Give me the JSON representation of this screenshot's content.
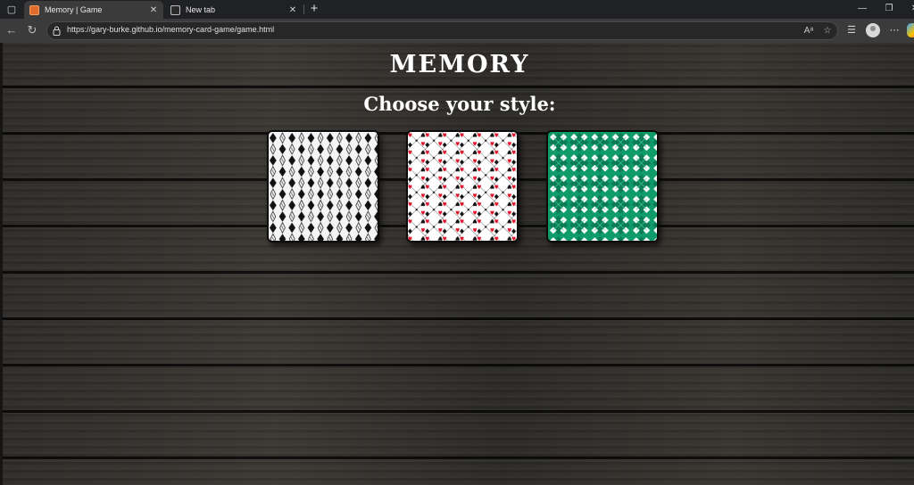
{
  "browser": {
    "tabs": [
      {
        "title": "Memory | Game",
        "active": true
      },
      {
        "title": "New tab",
        "active": false
      }
    ],
    "url": "https://gary-burke.github.io/memory-card-game/game.html"
  },
  "page": {
    "title": "MEMORY",
    "subtitle": "Choose your style:"
  },
  "styles": [
    {
      "name": "diamonds-white",
      "colors": {
        "bg": "#f4f4f4",
        "fg": "#111111"
      }
    },
    {
      "name": "suits-red-black",
      "colors": {
        "bg": "#ffffff",
        "fg": "#111111",
        "accent": "#e0122c"
      }
    },
    {
      "name": "argyle-green",
      "colors": {
        "bg": "#0f9b6a",
        "fg": "#ffffff",
        "dark": "#0b7c55"
      }
    }
  ]
}
